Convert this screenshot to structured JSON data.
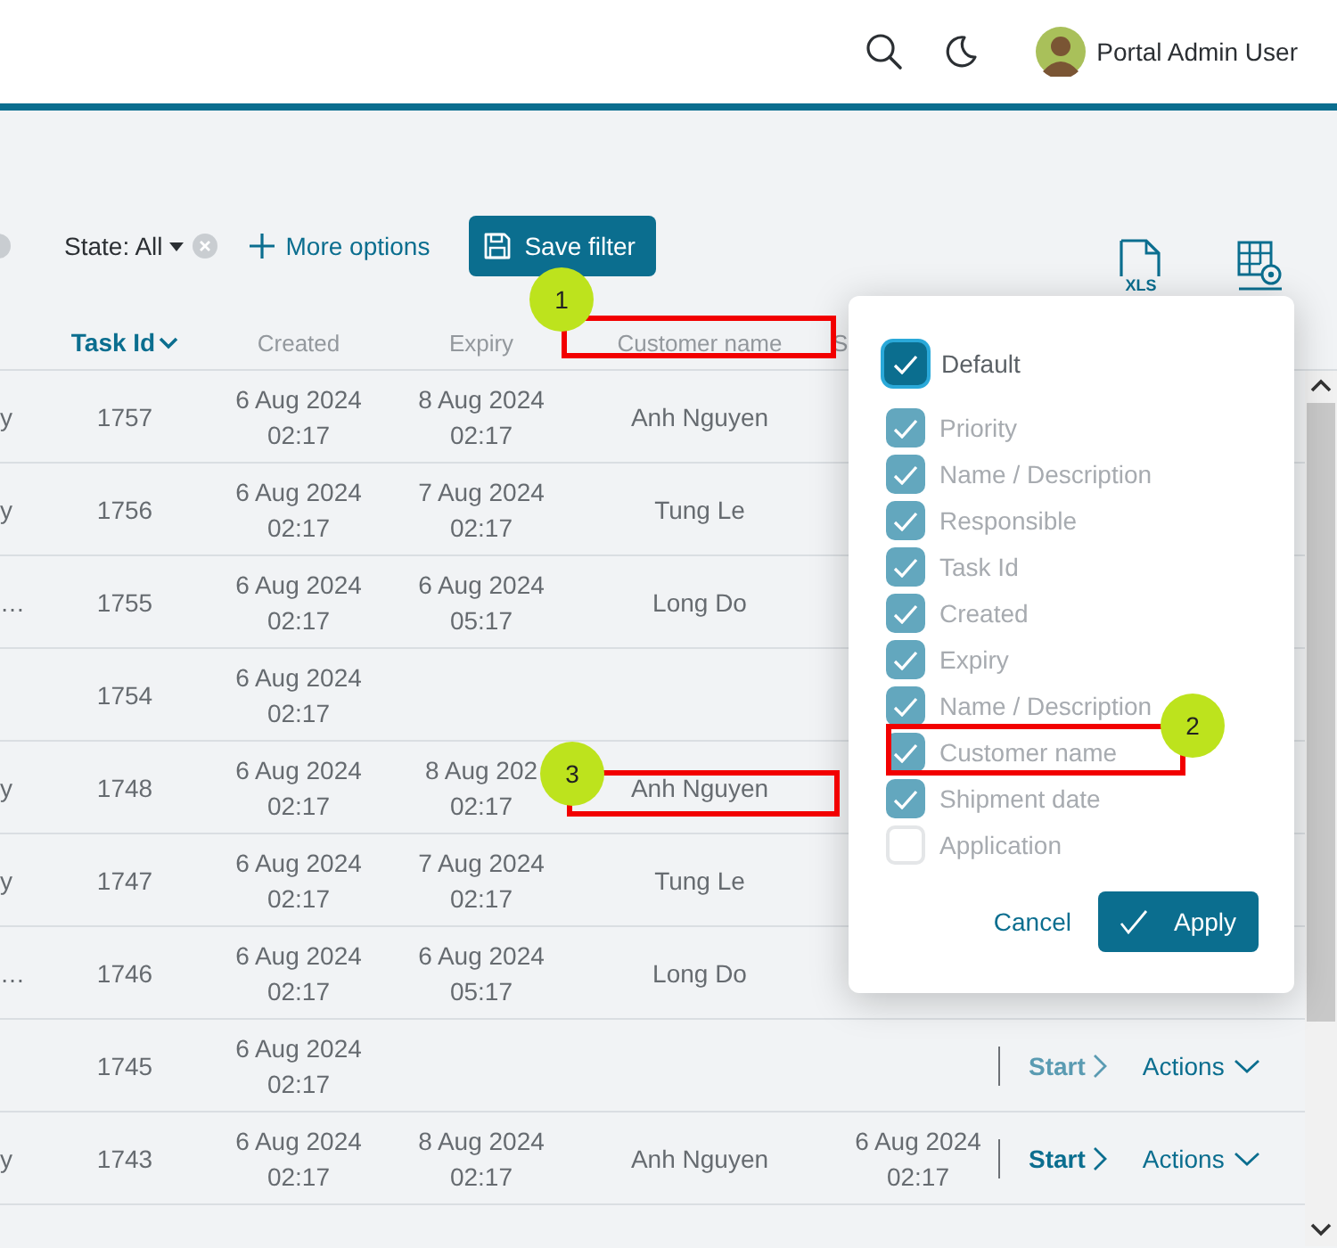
{
  "header": {
    "user_name": "Portal Admin User"
  },
  "filters": {
    "state_label": "State: All",
    "more_options": "More options",
    "save_filter": "Save filter",
    "export_label": "XLS"
  },
  "table": {
    "columns": [
      {
        "label": "Task Id",
        "sorted": true
      },
      {
        "label": "Created",
        "sorted": false
      },
      {
        "label": "Expiry",
        "sorted": false
      },
      {
        "label": "Customer name",
        "sorted": false
      },
      {
        "label": "S",
        "sorted": false
      }
    ],
    "rows": [
      {
        "column_1": "y",
        "task_id": "1757",
        "created": "6 Aug 2024 02:17",
        "expiry": "8 Aug 2024 02:17",
        "customer_name": "Anh Nguyen"
      },
      {
        "column_1": "y",
        "task_id": "1756",
        "created": "6 Aug 2024 02:17",
        "expiry": "7 Aug 2024 02:17",
        "customer_name": "Tung Le"
      },
      {
        "column_1": "…",
        "task_id": "1755",
        "created": "6 Aug 2024 02:17",
        "expiry": "6 Aug 2024 05:17",
        "customer_name": "Long Do"
      },
      {
        "task_id": "1754",
        "created": "6 Aug 2024 02:17"
      },
      {
        "column_1": "y",
        "task_id": "1748",
        "created": "6 Aug 2024 02:17",
        "expiry": "8 Aug 202 02:17",
        "customer_name": "Anh Nguyen"
      },
      {
        "column_1": "y",
        "task_id": "1747",
        "created": "6 Aug 2024 02:17",
        "expiry": "7 Aug 2024 02:17",
        "customer_name": "Tung Le"
      },
      {
        "column_1": "…",
        "task_id": "1746",
        "created": "6 Aug 2024 02:17",
        "expiry": "6 Aug 2024 05:17",
        "customer_name": "Long Do"
      },
      {
        "task_id": "1745",
        "created": "6 Aug 2024 02:17",
        "start": {
          "label": "Start",
          "disabled": true
        },
        "actions": "Actions"
      },
      {
        "column_1": "y",
        "task_id": "1743",
        "created": "6 Aug 2024 02:17",
        "expiry": "8 Aug 2024 02:17",
        "customer_name": "Anh Nguyen",
        "shipment_date": "6 Aug 2024 02:17",
        "start": {
          "label": "Start",
          "disabled": false
        },
        "actions": "Actions"
      }
    ]
  },
  "column_chooser": {
    "default": {
      "label": "Default",
      "checked": true
    },
    "items": [
      {
        "label": "Priority",
        "checked": true,
        "disabled": true
      },
      {
        "label": "Name / Description",
        "checked": true,
        "disabled": true
      },
      {
        "label": "Responsible",
        "checked": true,
        "disabled": true
      },
      {
        "label": "Task Id",
        "checked": true,
        "disabled": true
      },
      {
        "label": "Created",
        "checked": true,
        "disabled": true
      },
      {
        "label": "Expiry",
        "checked": true,
        "disabled": true
      },
      {
        "label": "Name / Description",
        "checked": true,
        "disabled": true
      },
      {
        "label": "Customer name",
        "checked": true,
        "disabled": true
      },
      {
        "label": "Shipment date",
        "checked": true,
        "disabled": true
      },
      {
        "label": "Application",
        "checked": false,
        "disabled": true
      }
    ],
    "cancel": "Cancel",
    "apply": "Apply"
  },
  "annotations": [
    {
      "number": "1"
    },
    {
      "number": "2"
    },
    {
      "number": "3"
    }
  ]
}
